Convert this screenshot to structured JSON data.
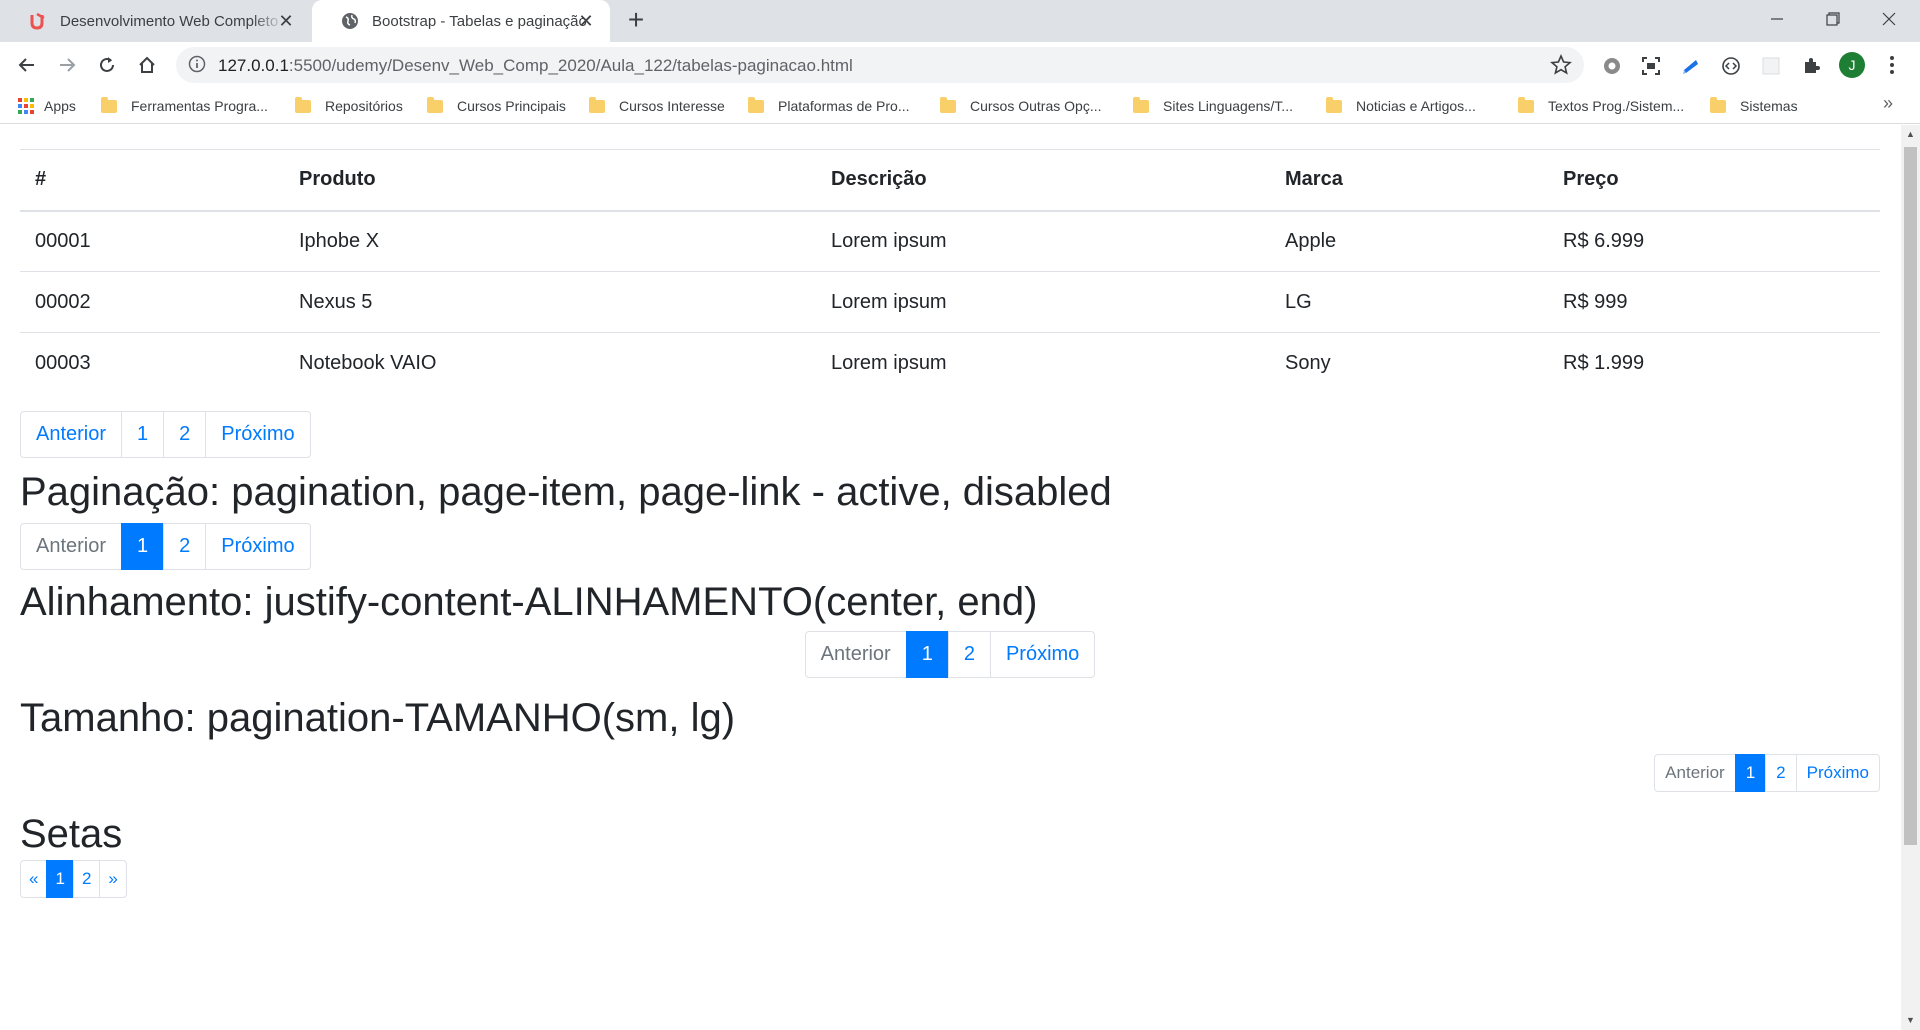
{
  "browser": {
    "tabs": [
      {
        "title": "Desenvolvimento Web Completo 2020",
        "close": "✕"
      },
      {
        "title": "Bootstrap - Tabelas e paginação",
        "close": "✕"
      }
    ],
    "new_tab": "+",
    "url_host": "127.0.0.1",
    "url_path": ":5500/udemy/Desenv_Web_Comp_2020/Aula_122/tabelas-paginacao.html",
    "profile_initial": "J",
    "bookmarks": [
      "Apps",
      "Ferramentas Progra...",
      "Repositórios",
      "Cursos Principais",
      "Cursos Interesse",
      "Plataformas de Pro...",
      "Cursos Outras Opç...",
      "Sites Linguagens/T...",
      "Noticias e Artigos...",
      "Textos Prog./Sistem...",
      "Sistemas"
    ],
    "bookmarks_more": "»"
  },
  "table": {
    "headers": [
      "#",
      "Produto",
      "Descrição",
      "Marca",
      "Preço"
    ],
    "rows": [
      [
        "00001",
        "Iphobe X",
        "Lorem ipsum",
        "Apple",
        "R$ 6.999"
      ],
      [
        "00002",
        "Nexus 5",
        "Lorem ipsum",
        "LG",
        "R$ 999"
      ],
      [
        "00003",
        "Notebook VAIO",
        "Lorem ipsum",
        "Sony",
        "R$ 1.999"
      ]
    ]
  },
  "pagination_basic": {
    "prev": "Anterior",
    "p1": "1",
    "p2": "2",
    "next": "Próximo"
  },
  "section_pagination": {
    "title": "Paginação: pagination, page-item, page-link - active, disabled",
    "prev": "Anterior",
    "p1": "1",
    "p2": "2",
    "next": "Próximo"
  },
  "section_alignment": {
    "title": "Alinhamento: justify-content-ALINHAMENTO(center, end)",
    "prev": "Anterior",
    "p1": "1",
    "p2": "2",
    "next": "Próximo"
  },
  "section_size": {
    "title": "Tamanho: pagination-TAMANHO(sm, lg)",
    "prev": "Anterior",
    "p1": "1",
    "p2": "2",
    "next": "Próximo"
  },
  "section_arrows": {
    "title": "Setas",
    "prev": "«",
    "p1": "1",
    "p2": "2",
    "next": "»"
  },
  "colors": {
    "primary": "#007bff",
    "disabled": "#6c757d",
    "text": "#212529",
    "border": "#dee2e6",
    "tabbar": "#dee1e6"
  }
}
